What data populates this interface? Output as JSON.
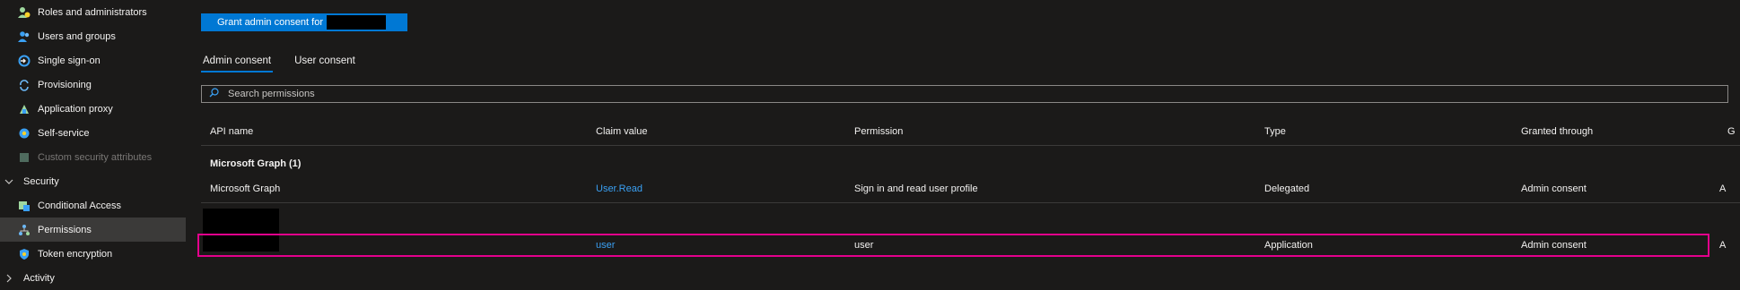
{
  "sidebar": {
    "items": [
      {
        "label": "Roles and administrators",
        "icon": "roles-icon"
      },
      {
        "label": "Users and groups",
        "icon": "users-icon"
      },
      {
        "label": "Single sign-on",
        "icon": "sso-icon"
      },
      {
        "label": "Provisioning",
        "icon": "provisioning-icon"
      },
      {
        "label": "Application proxy",
        "icon": "app-proxy-icon"
      },
      {
        "label": "Self-service",
        "icon": "self-service-icon"
      },
      {
        "label": "Custom security attributes",
        "icon": "custom-attributes-icon"
      }
    ],
    "section_security": "Security",
    "security_items": [
      {
        "label": "Conditional Access",
        "icon": "conditional-access-icon"
      },
      {
        "label": "Permissions",
        "icon": "permissions-icon"
      },
      {
        "label": "Token encryption",
        "icon": "token-encryption-icon"
      }
    ],
    "section_activity": "Activity"
  },
  "toolbar": {
    "grant_label": "Grant admin consent for"
  },
  "tabs": [
    {
      "label": "Admin consent",
      "selected": true
    },
    {
      "label": "User consent",
      "selected": false
    }
  ],
  "search": {
    "placeholder": "Search permissions"
  },
  "table": {
    "columns": [
      "API name",
      "Claim value",
      "Permission",
      "Type",
      "Granted through",
      "G"
    ],
    "group_label": "Microsoft Graph (1)",
    "rows": [
      {
        "api": "Microsoft Graph",
        "claim": "User.Read",
        "permission": "Sign in and read user profile",
        "type": "Delegated",
        "granted": "Admin consent",
        "extra": "A"
      },
      {
        "api": "",
        "claim": "user",
        "permission": "user",
        "type": "Application",
        "granted": "Admin consent",
        "extra": "A"
      }
    ]
  },
  "colors": {
    "accent": "#0078d4",
    "link": "#3aa0f3",
    "highlight": "#e3008c",
    "background": "#1b1a19"
  }
}
